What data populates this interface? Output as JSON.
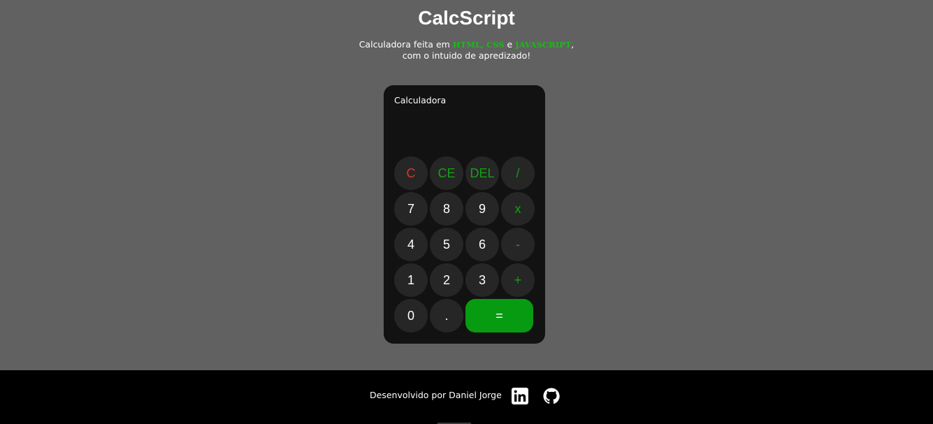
{
  "header": {
    "title": "CalcScript",
    "subtitle": {
      "prefix": "Calculadora feita em ",
      "tech1": "HTML, CSS",
      "mid": " e ",
      "tech2": "JAVASCRIPT",
      "suffix": ",",
      "line2": "com o intuido de apredizado!"
    }
  },
  "calculator": {
    "label": "Calculadora",
    "display": "",
    "keys": {
      "clear": "C",
      "clear_entry": "CE",
      "delete": "DEL",
      "divide": "/",
      "seven": "7",
      "eight": "8",
      "nine": "9",
      "multiply": "x",
      "four": "4",
      "five": "5",
      "six": "6",
      "minus": "-",
      "one": "1",
      "two": "2",
      "three": "3",
      "plus": "+",
      "zero": "0",
      "decimal": ".",
      "equals": "="
    }
  },
  "footer": {
    "credit": "Desenvolvido por Daniel Jorge",
    "links": [
      {
        "icon": "linkedin-icon"
      },
      {
        "icon": "github-icon"
      }
    ]
  },
  "colors": {
    "page_background": "#616161",
    "calculator_background": "#121212",
    "key_background": "#262626",
    "accent_green": "#079b11",
    "operator_green": "#14a014",
    "clear_red": "#d13a2b",
    "tech_green": "#1db81d",
    "footer_background": "#000000"
  }
}
